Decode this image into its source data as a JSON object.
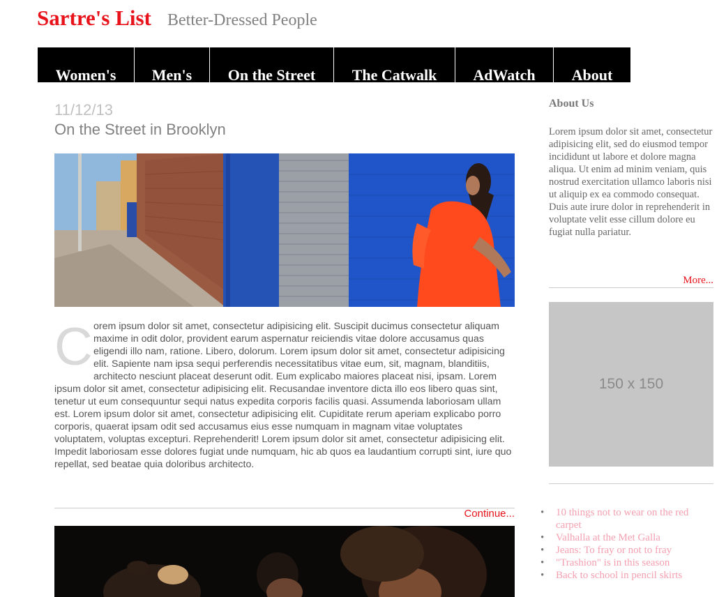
{
  "site": {
    "title": "Sartre's List",
    "tagline": "Better-Dressed People"
  },
  "nav": {
    "items": [
      {
        "label": "Women's"
      },
      {
        "label": "Men's"
      },
      {
        "label": "On the Street"
      },
      {
        "label": "The Catwalk"
      },
      {
        "label": "AdWatch"
      },
      {
        "label": "About"
      }
    ]
  },
  "post": {
    "date": "11/12/13",
    "title": "On the Street in Brooklyn",
    "dropcap": "C",
    "body": "orem ipsum dolor sit amet, consectetur adipisicing elit. Suscipit ducimus consectetur aliquam maxime in odit dolor, provident earum aspernatur reiciendis vitae dolore accusamus quas eligendi illo nam, ratione. Libero, dolorum. Lorem ipsum dolor sit amet, consectetur adipisicing elit. Sapiente nam ipsa sequi perferendis necessitatibus vitae eum, sit, magnam, blanditiis, architecto nesciunt placeat deserunt odit. Eum explicabo maiores placeat nisi, ipsam. Lorem ipsum dolor sit amet, consectetur adipisicing elit. Recusandae inventore dicta illo eos libero quas sint, tenetur ut eum consequuntur sequi natus expedita corporis facilis quasi. Assumenda laboriosam ullam est. Lorem ipsum dolor sit amet, consectetur adipisicing elit. Cupiditate rerum aperiam explicabo porro corporis, quaerat ipsam odit sed accusamus eius esse numquam in magnam vitae voluptates voluptatem, voluptas excepturi. Reprehenderit! Lorem ipsum dolor sit amet, consectetur adipisicing elit. Impedit laboriosam esse dolores fugiat unde numquam, hic ab quos ea laudantium corrupti sint, iure quo repellat, sed beatae quia doloribus architecto.",
    "continue_label": "Continue..."
  },
  "aside": {
    "title": "About Us",
    "text": "Lorem ipsum dolor sit amet, consectetur adipisicing elit, sed do eiusmod tempor incididunt ut labore et dolore magna aliqua. Ut enim ad minim veniam, quis nostrud exercitation ullamco laboris nisi ut aliquip ex ea commodo consequat. Duis aute irure dolor in reprehenderit in voluptate velit esse cillum dolore eu fugiat nulla pariatur.",
    "more_label": "More...",
    "ad_label": "150 x 150",
    "links": [
      {
        "label": "10 things not to wear on the red carpet"
      },
      {
        "label": "Valhalla at the Met Galla"
      },
      {
        "label": "Jeans: To fray or not to fray"
      },
      {
        "label": "\"Trashion\" is in this season"
      },
      {
        "label": "Back to school in pencil skirts"
      }
    ]
  },
  "colors": {
    "brand_red": "#e8121b",
    "nav_bg": "#000000",
    "link_pink": "#f4a0b0",
    "placeholder_gray": "#c6c6c6"
  }
}
